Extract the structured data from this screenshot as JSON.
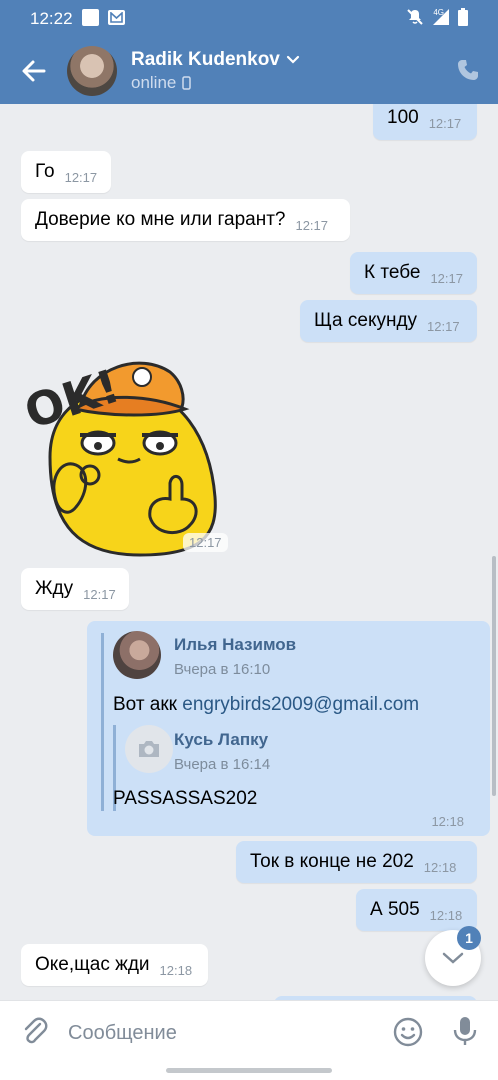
{
  "status_bar": {
    "time": "12:22",
    "network": "4G"
  },
  "header": {
    "contact_name": "Radik Kudenkov",
    "status": "online"
  },
  "messages": [
    {
      "text": "100",
      "time": "12:17",
      "dir": "out"
    },
    {
      "text": "Го",
      "time": "12:17",
      "dir": "in"
    },
    {
      "text": "Доверие ко мне или гарант?",
      "time": "12:17",
      "dir": "in"
    },
    {
      "text": "К тебе",
      "time": "12:17",
      "dir": "out"
    },
    {
      "text": "Ща секунду",
      "time": "12:17",
      "dir": "out"
    },
    {
      "text": "Жду",
      "time": "12:17",
      "dir": "in"
    },
    {
      "text": "Ток в конце не 202",
      "time": "12:18",
      "dir": "out"
    },
    {
      "text": "А 505",
      "time": "12:18",
      "dir": "out"
    },
    {
      "text": "Оке,щас жди",
      "time": "12:18",
      "dir": "in"
    }
  ],
  "sticker": {
    "label": "OK!",
    "time": "12:17"
  },
  "forwarded": {
    "time": "12:18",
    "author1": "Илья Назимов",
    "date1": "Вчера в 16:10",
    "text_prefix": "Вот акк ",
    "email": "engrybirds2009@gmail.com",
    "author2": "Кусь Лапку",
    "date2": "Вчера в 16:14",
    "text2": "PASSASSAS202"
  },
  "unread_badge": "1",
  "input": {
    "placeholder": "Сообщение"
  },
  "colors": {
    "header": "#5181b8",
    "outgoing": "#cce0f7",
    "incoming": "#ffffff",
    "background": "#ebedf0"
  }
}
